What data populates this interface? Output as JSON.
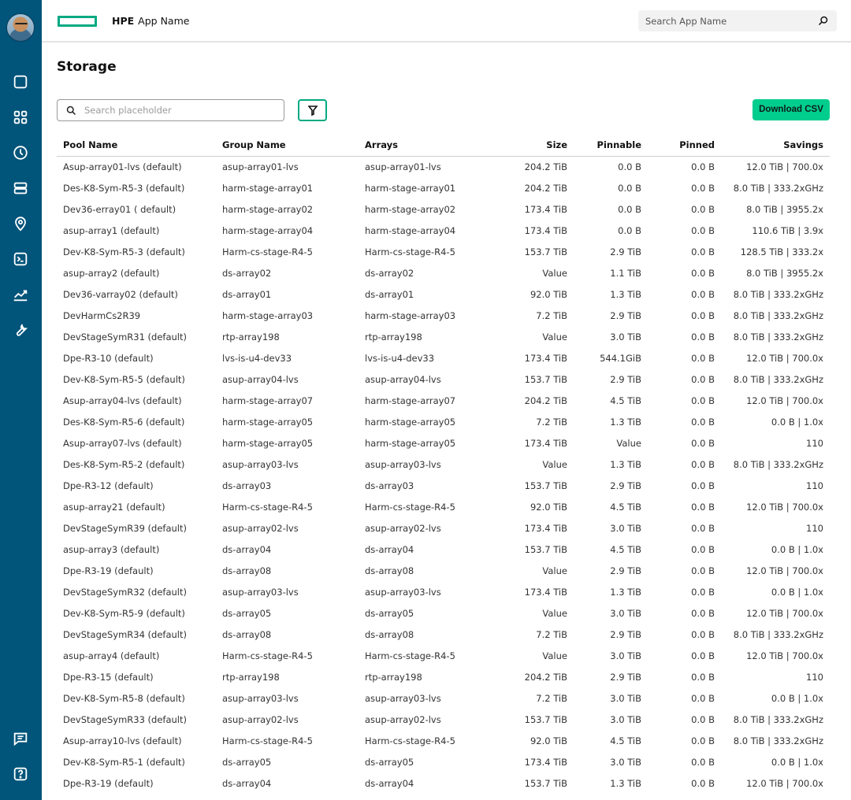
{
  "header": {
    "brand": "HPE",
    "app_name": "App Name",
    "search_placeholder": "Search App Name"
  },
  "colors": {
    "sidebar": "#01547a",
    "brand_green": "#01a982",
    "download_button": "#01cd8c"
  },
  "sidebar": {
    "icons": [
      "square-icon",
      "apps-grid-icon",
      "clock-icon",
      "storage-icon",
      "location-icon",
      "terminal-icon",
      "chart-line-icon",
      "wrench-icon",
      "chat-icon",
      "help-icon"
    ]
  },
  "page": {
    "title": "Storage",
    "search_placeholder": "Search placeholder",
    "download_label": "Download CSV"
  },
  "table": {
    "columns": [
      "Pool Name",
      "Group Name",
      "Arrays",
      "Size",
      "Pinnable",
      "Pinned",
      "Savings"
    ],
    "rows": [
      [
        "Asup-array01-lvs (default)",
        "asup-array01-lvs",
        "asup-array01-lvs",
        "204.2 TiB",
        "0.0 B",
        "0.0 B",
        "12.0 TiB | 700.0x"
      ],
      [
        "Des-K8-Sym-R5-3 (default)",
        "harm-stage-array01",
        "harm-stage-array01",
        "204.2 TiB",
        "0.0 B",
        "0.0 B",
        "8.0 TiB | 333.2xGHz"
      ],
      [
        "Dev36-erray01 ( default)",
        "harm-stage-array02",
        "harm-stage-array02",
        "173.4 TiB",
        "0.0 B",
        "0.0 B",
        "8.0 TiB | 3955.2x"
      ],
      [
        "asup-array1 (default)",
        "harm-stage-array04",
        "harm-stage-array04",
        "173.4 TiB",
        "0.0 B",
        "0.0 B",
        "110.6 TiB | 3.9x"
      ],
      [
        "Dev-K8-Sym-R5-3 (default)",
        "Harm-cs-stage-R4-5",
        "Harm-cs-stage-R4-5",
        "153.7 TiB",
        "2.9 TiB",
        "0.0 B",
        "128.5 TiB | 333.2x"
      ],
      [
        "asup-array2 (default)",
        "ds-array02",
        "ds-array02",
        "Value",
        "1.1 TiB",
        "0.0 B",
        "8.0 TiB | 3955.2x"
      ],
      [
        "Dev36-varray02 (default)",
        "ds-array01",
        "ds-array01",
        "92.0 TiB",
        "1.3 TiB",
        "0.0 B",
        "8.0 TiB | 333.2xGHz"
      ],
      [
        "DevHarmCs2R39",
        "harm-stage-array03",
        "harm-stage-array03",
        "7.2 TiB",
        "2.9 TiB",
        "0.0 B",
        "8.0 TiB | 333.2xGHz"
      ],
      [
        "DevStageSymR31 (default)",
        "rtp-array198",
        "rtp-array198",
        "Value",
        "3.0 TiB",
        "0.0 B",
        "8.0 TiB | 333.2xGHz"
      ],
      [
        "Dpe-R3-10 (default)",
        "lvs-is-u4-dev33",
        "lvs-is-u4-dev33",
        "173.4 TiB",
        "544.1GiB",
        "0.0 B",
        "12.0 TiB | 700.0x"
      ],
      [
        "Dev-K8-Sym-R5-5 (default)",
        "asup-array04-lvs",
        "asup-array04-lvs",
        "153.7 TiB",
        "2.9 TiB",
        "0.0 B",
        "8.0 TiB | 333.2xGHz"
      ],
      [
        "Asup-array04-lvs (default)",
        "harm-stage-array07",
        "harm-stage-array07",
        "204.2 TiB",
        "4.5 TiB",
        "0.0 B",
        "12.0 TiB | 700.0x"
      ],
      [
        "Des-K8-Sym-R5-6 (default)",
        "harm-stage-array05",
        "harm-stage-array05",
        "7.2 TiB",
        "1.3 TiB",
        "0.0 B",
        "0.0 B | 1.0x"
      ],
      [
        "Asup-array07-lvs (default)",
        "harm-stage-array05",
        "harm-stage-array05",
        "173.4 TiB",
        "Value",
        "0.0 B",
        "110"
      ],
      [
        "Des-K8-Sym-R5-2 (default)",
        "asup-array03-lvs",
        "asup-array03-lvs",
        "Value",
        "1.3 TiB",
        "0.0 B",
        "8.0 TiB | 333.2xGHz"
      ],
      [
        "Dpe-R3-12 (default)",
        "ds-array03",
        "ds-array03",
        "153.7 TiB",
        "2.9 TiB",
        "0.0 B",
        "110"
      ],
      [
        "asup-array21 (default)",
        "Harm-cs-stage-R4-5",
        "Harm-cs-stage-R4-5",
        "92.0 TiB",
        "4.5 TiB",
        "0.0 B",
        "12.0 TiB | 700.0x"
      ],
      [
        "DevStageSymR39 (default)",
        "asup-array02-lvs",
        "asup-array02-lvs",
        "173.4 TiB",
        "3.0 TiB",
        "0.0 B",
        "110"
      ],
      [
        "asup-array3 (default)",
        "ds-array04",
        "ds-array04",
        "153.7 TiB",
        "4.5 TiB",
        "0.0 B",
        "0.0 B | 1.0x"
      ],
      [
        "Dpe-R3-19 (default)",
        "ds-array08",
        "ds-array08",
        "Value",
        "2.9 TiB",
        "0.0 B",
        "12.0 TiB | 700.0x"
      ],
      [
        "DevStageSymR32 (default)",
        "asup-array03-lvs",
        "asup-array03-lvs",
        "173.4 TiB",
        "1.3 TiB",
        "0.0 B",
        "0.0 B | 1.0x"
      ],
      [
        "Dev-K8-Sym-R5-9 (default)",
        "ds-array05",
        "ds-array05",
        "Value",
        "3.0 TiB",
        "0.0 B",
        "12.0 TiB | 700.0x"
      ],
      [
        "DevStageSymR34 (default)",
        "ds-array08",
        "ds-array08",
        "7.2 TiB",
        "2.9 TiB",
        "0.0 B",
        "8.0 TiB | 333.2xGHz"
      ],
      [
        "asup-array4 (default)",
        "Harm-cs-stage-R4-5",
        "Harm-cs-stage-R4-5",
        "Value",
        "3.0 TiB",
        "0.0 B",
        "12.0 TiB | 700.0x"
      ],
      [
        "Dpe-R3-15 (default)",
        "rtp-array198",
        "rtp-array198",
        "204.2 TiB",
        "2.9 TiB",
        "0.0 B",
        "110"
      ],
      [
        "Dev-K8-Sym-R5-8 (default)",
        "asup-array03-lvs",
        "asup-array03-lvs",
        "7.2 TiB",
        "3.0 TiB",
        "0.0 B",
        "0.0 B | 1.0x"
      ],
      [
        "DevStageSymR33 (default)",
        "asup-array02-lvs",
        "asup-array02-lvs",
        "153.7 TiB",
        "3.0 TiB",
        "0.0 B",
        "8.0 TiB | 333.2xGHz"
      ],
      [
        "Asup-array10-lvs (default)",
        "Harm-cs-stage-R4-5",
        "Harm-cs-stage-R4-5",
        "92.0 TiB",
        "4.5 TiB",
        "0.0 B",
        "8.0 TiB | 333.2xGHz"
      ],
      [
        "Dev-K8-Sym-R5-1 (default)",
        "ds-array05",
        "ds-array05",
        "173.4 TiB",
        "3.0 TiB",
        "0.0 B",
        "0.0 B | 1.0x"
      ],
      [
        "Dpe-R3-19 (default)",
        "ds-array04",
        "ds-array04",
        "153.7 TiB",
        "1.3 TiB",
        "0.0 B",
        "12.0 TiB | 700.0x"
      ]
    ]
  }
}
